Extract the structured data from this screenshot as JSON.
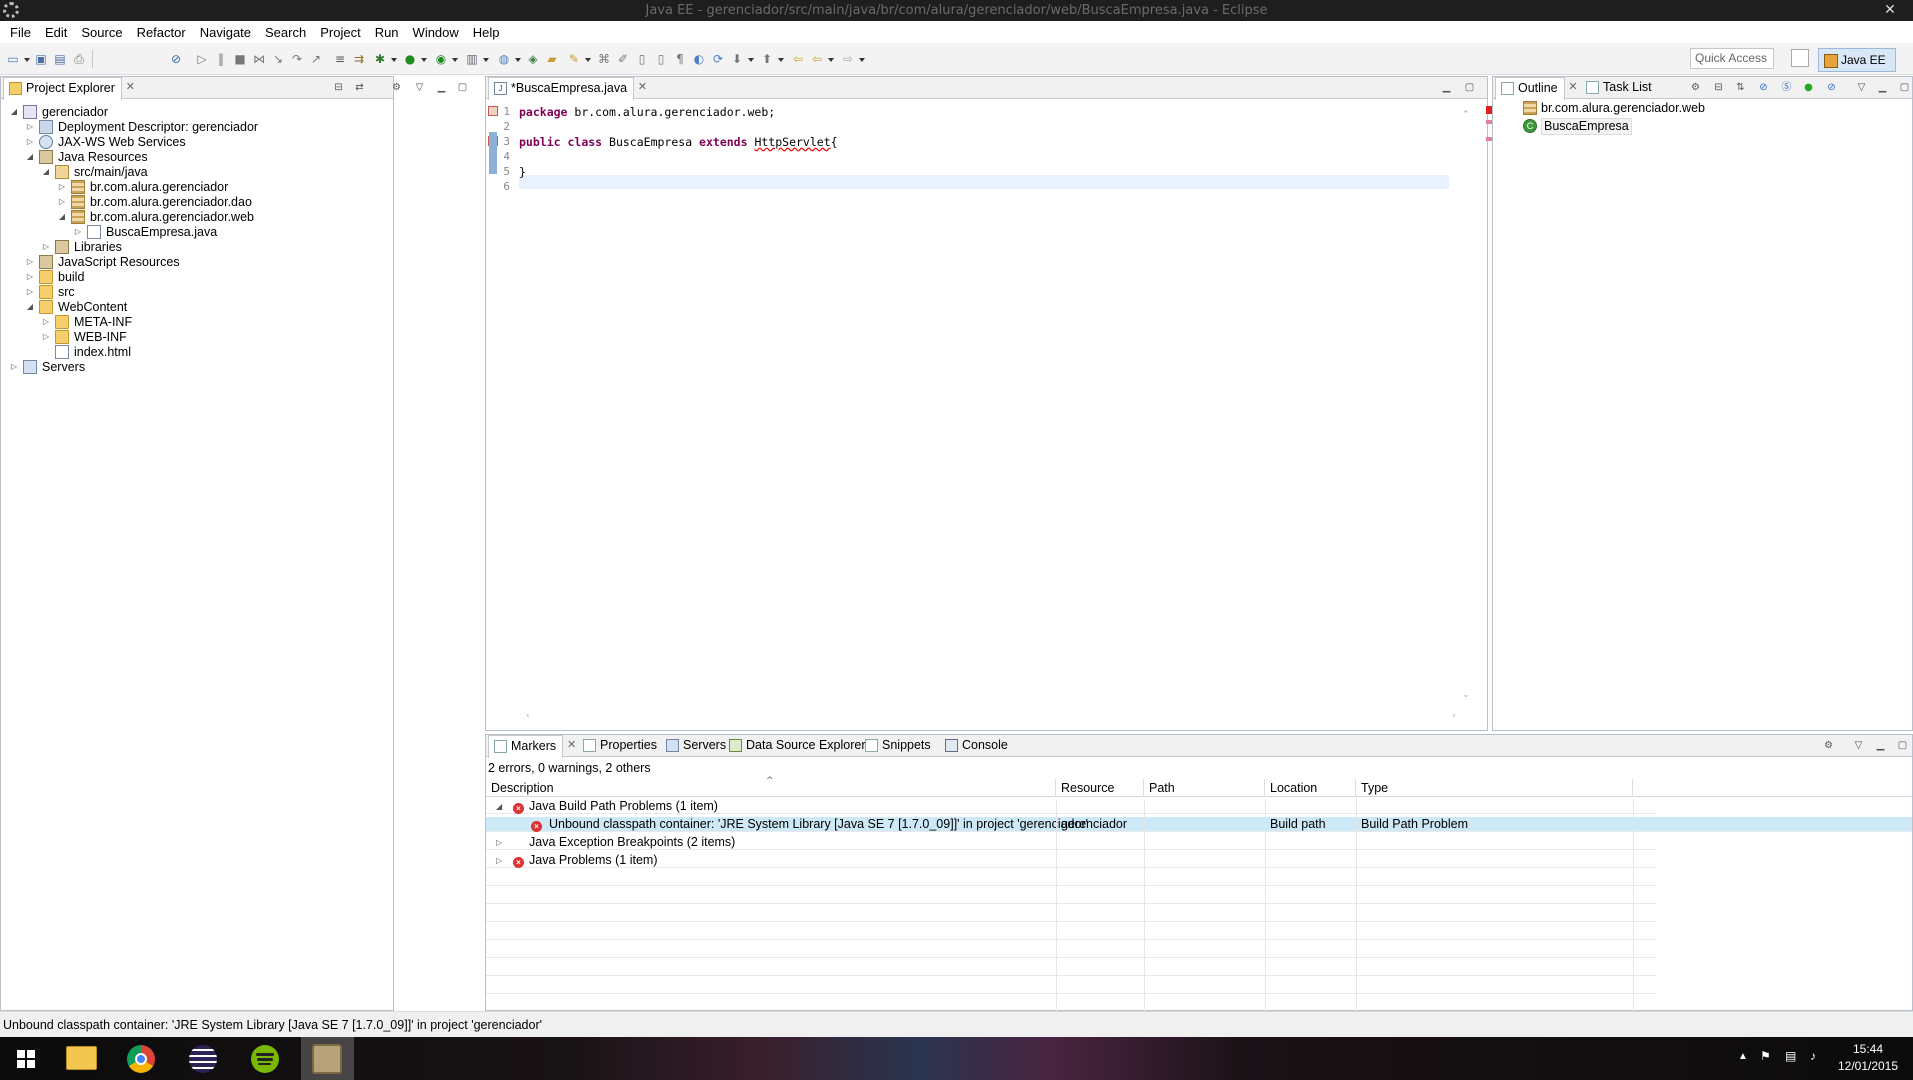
{
  "window": {
    "title": "Java EE - gerenciador/src/main/java/br/com/alura/gerenciador/web/BuscaEmpresa.java - Eclipse"
  },
  "menu": [
    "File",
    "Edit",
    "Source",
    "Refactor",
    "Navigate",
    "Search",
    "Project",
    "Run",
    "Window",
    "Help"
  ],
  "toolbar": {
    "quick_access": "Quick Access",
    "perspective": "Java EE"
  },
  "project_explorer": {
    "tab": "Project Explorer",
    "tree": [
      {
        "label": "gerenciador",
        "icon": "project-icon",
        "twisty": "expanded"
      },
      {
        "label": "Deployment Descriptor: gerenciador",
        "icon": "descriptor-icon",
        "twisty": "collapsed"
      },
      {
        "label": "JAX-WS Web Services",
        "icon": "webservice-icon",
        "twisty": "collapsed"
      },
      {
        "label": "Java Resources",
        "icon": "java-resources-icon",
        "twisty": "expanded"
      },
      {
        "label": "src/main/java",
        "icon": "source-folder-icon",
        "twisty": "expanded"
      },
      {
        "label": "br.com.alura.gerenciador",
        "icon": "package-icon",
        "twisty": "collapsed"
      },
      {
        "label": "br.com.alura.gerenciador.dao",
        "icon": "package-icon",
        "twisty": "collapsed"
      },
      {
        "label": "br.com.alura.gerenciador.web",
        "icon": "package-icon",
        "twisty": "expanded"
      },
      {
        "label": "BuscaEmpresa.java",
        "icon": "java-file-icon",
        "twisty": "collapsed"
      },
      {
        "label": "Libraries",
        "icon": "library-icon",
        "twisty": "collapsed"
      },
      {
        "label": "JavaScript Resources",
        "icon": "js-resources-icon",
        "twisty": "collapsed"
      },
      {
        "label": "build",
        "icon": "folder-icon",
        "twisty": "collapsed"
      },
      {
        "label": "src",
        "icon": "folder-icon",
        "twisty": "collapsed"
      },
      {
        "label": "WebContent",
        "icon": "folder-icon",
        "twisty": "expanded"
      },
      {
        "label": "META-INF",
        "icon": "folder-icon",
        "twisty": "collapsed"
      },
      {
        "label": "WEB-INF",
        "icon": "folder-icon",
        "twisty": "collapsed"
      },
      {
        "label": "index.html",
        "icon": "html-file-icon",
        "twisty": "none"
      },
      {
        "label": "Servers",
        "icon": "server-folder-icon",
        "twisty": "collapsed"
      }
    ]
  },
  "editor": {
    "tab": "*BuscaEmpresa.java",
    "lines": [
      {
        "num": "1",
        "tokens": [
          {
            "t": "package",
            "k": "kw"
          },
          {
            "t": " br.com.alura.gerenciador.web;",
            "k": ""
          }
        ]
      },
      {
        "num": "2",
        "tokens": []
      },
      {
        "num": "3",
        "tokens": [
          {
            "t": "public",
            "k": "kw"
          },
          {
            "t": " ",
            "k": ""
          },
          {
            "t": "class",
            "k": "kw"
          },
          {
            "t": " BuscaEmpresa ",
            "k": ""
          },
          {
            "t": "extends",
            "k": "kw"
          },
          {
            "t": " ",
            "k": ""
          },
          {
            "t": "HttpServlet",
            "k": "err"
          },
          {
            "t": "{",
            "k": ""
          }
        ]
      },
      {
        "num": "4",
        "tokens": []
      },
      {
        "num": "5",
        "tokens": [
          {
            "t": "}",
            "k": ""
          }
        ]
      },
      {
        "num": "6",
        "tokens": []
      }
    ]
  },
  "outline": {
    "tabs": [
      "Outline",
      "Task List"
    ],
    "items": [
      {
        "label": "br.com.alura.gerenciador.web",
        "icon": "package-icon"
      },
      {
        "label": "BuscaEmpresa",
        "icon": "class-icon"
      }
    ]
  },
  "bottom_panel": {
    "tabs": [
      "Markers",
      "Properties",
      "Servers",
      "Data Source Explorer",
      "Snippets",
      "Console"
    ],
    "summary": "2 errors, 0 warnings, 2 others",
    "columns": [
      "Description",
      "Resource",
      "Path",
      "Location",
      "Type"
    ],
    "rows": [
      {
        "description": "Java Build Path Problems (1 item)",
        "resource": "",
        "path": "",
        "location": "",
        "type": "",
        "level": 0,
        "twisty": "expanded",
        "icon": "error-icon",
        "selected": false
      },
      {
        "description": "Unbound classpath container: 'JRE System Library [Java SE 7 [1.7.0_09]]' in project 'gerenciador'",
        "resource": "gerenciador",
        "path": "",
        "location": "Build path",
        "type": "Build Path Problem",
        "level": 1,
        "twisty": "none",
        "icon": "build-error-icon",
        "selected": true
      },
      {
        "description": "Java Exception Breakpoints (2 items)",
        "resource": "",
        "path": "",
        "location": "",
        "type": "",
        "level": 0,
        "twisty": "collapsed",
        "icon": "none",
        "selected": false
      },
      {
        "description": "Java Problems (1 item)",
        "resource": "",
        "path": "",
        "location": "",
        "type": "",
        "level": 0,
        "twisty": "collapsed",
        "icon": "error-icon",
        "selected": false
      }
    ]
  },
  "status_bar": {
    "message": "Unbound classpath container: 'JRE System Library [Java SE 7 [1.7.0_09]]' in project 'gerenciador'"
  },
  "taskbar": {
    "apps": [
      "start",
      "file-explorer",
      "chrome",
      "eclipse",
      "spotify",
      "java-ee-eclipse"
    ],
    "time": "15:44",
    "date": "12/01/2015"
  },
  "colors": {
    "keyword": "#7f0055",
    "selection": "#cde8f6",
    "error": "#d33333"
  }
}
